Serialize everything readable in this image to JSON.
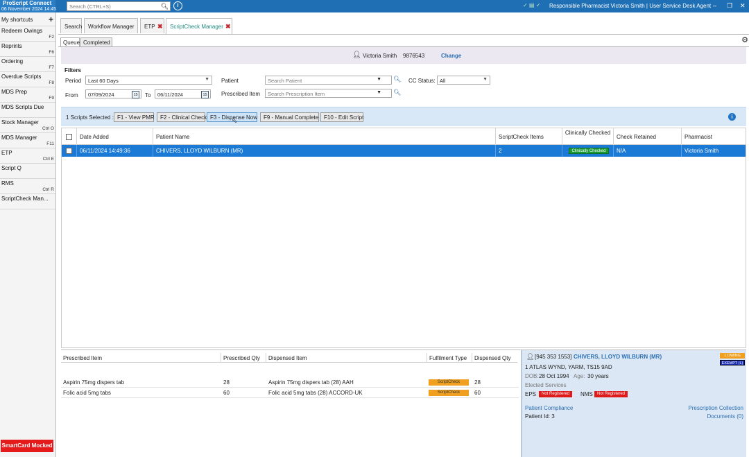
{
  "app": {
    "name": "ProScript Connect",
    "datetime": "06 November 2024 14:45",
    "search_placeholder": "Search (CTRL+S)",
    "status_icons": "✓ ▤ ✓",
    "responsible_pharmacist": "Responsible Pharmacist Victoria Smith",
    "user_role": "User Service Desk Agent"
  },
  "sidebar": {
    "shortcuts_label": "My shortcuts",
    "items": [
      {
        "label": "Redeem Owings",
        "key": "F2"
      },
      {
        "label": "Reprints",
        "key": "F6"
      },
      {
        "label": "Ordering",
        "key": "F7"
      },
      {
        "label": "Overdue Scripts",
        "key": "F8"
      },
      {
        "label": "MDS Prep",
        "key": "F9"
      },
      {
        "label": "MDS Scripts Due",
        "key": ""
      },
      {
        "label": "Stock Manager",
        "key": "Ctrl O"
      },
      {
        "label": "MDS Manager",
        "key": "F11"
      },
      {
        "label": "ETP",
        "key": "Ctrl E"
      },
      {
        "label": "Script Q",
        "key": ""
      },
      {
        "label": "RMS",
        "key": "Ctrl R"
      },
      {
        "label": "ScriptCheck Man...",
        "key": ""
      }
    ],
    "smartcard": "SmartCard Mocked"
  },
  "tabs": [
    {
      "label": "Search"
    },
    {
      "label": "Workflow Manager"
    },
    {
      "label": "ETP"
    },
    {
      "label": "ScriptCheck Manager"
    }
  ],
  "subtabs": [
    {
      "label": "Queue"
    },
    {
      "label": "Completed"
    }
  ],
  "user": {
    "name": "Victoria Smith",
    "id": "9876543",
    "change": "Change"
  },
  "filters": {
    "title": "Filters",
    "period_label": "Period",
    "period_value": "Last 60 Days",
    "from_label": "From",
    "from_value": "07/09/2024",
    "to_label": "To",
    "to_value": "06/11/2024",
    "patient_label": "Patient",
    "patient_placeholder": "Search Patient",
    "prescribed_label": "Prescribed Item",
    "prescribed_placeholder": "Search Prescription Item",
    "cc_status_label": "CC Status:",
    "cc_status_value": "All"
  },
  "actions": {
    "selected": "1 Scripts Selected :",
    "buttons": [
      "F1 - View PMR",
      "F2 - Clinical Check",
      "F3 - Dispense Now",
      "F9 - Manual Complete",
      "F10 - Edit Script"
    ]
  },
  "grid": {
    "headers": [
      "Date Added",
      "Patient Name",
      "ScriptCheck Items",
      "Clinically Checked",
      "Check Retained",
      "Pharmacist"
    ],
    "row": {
      "date": "06/11/2024 14:49:36",
      "patient": "CHIVERS, LLOYD WILBURN (MR)",
      "items": "2",
      "clinically": "Clinically Checked",
      "retained": "N/A",
      "pharmacist": "Victoria  Smith"
    }
  },
  "items_table": {
    "headers": [
      "Prescribed Item",
      "Prescribed Qty",
      "Dispensed Item",
      "Fulfilment Type",
      "Dispensed Qty"
    ],
    "rows": [
      {
        "prescribed": "Aspirin 75mg dispers tab",
        "pqty": "28",
        "dispensed": "Aspirin 75mg dispers tab (28) AAH",
        "type": "ScriptCheck",
        "dqty": "28"
      },
      {
        "prescribed": "Folic acid 5mg tabs",
        "pqty": "60",
        "dispensed": "Folic acid 5mg tabs (28) ACCORD-UK",
        "type": "ScriptCheck",
        "dqty": "60"
      }
    ]
  },
  "patient": {
    "nhs": "[945 353 1553]",
    "name": "CHIVERS, LLOYD WILBURN (MR)",
    "owing": "1 OWING",
    "exempt": "EXEMPT (L)",
    "address": "1 ATLAS WYND, YARM, TS15 9AD",
    "dob_label": "DOB:",
    "dob": "28 Oct 1994",
    "age_label": "Age:",
    "age": "30 years",
    "elected": "Elected Services",
    "eps_label": "EPS",
    "eps_status": "Not Registered",
    "nms_label": "NMS",
    "nms_status": "Not Registered",
    "compliance": "Patient Compliance",
    "collection": "Prescription Collection",
    "patient_id": "Patient Id: 3",
    "documents": "Documents (0)"
  }
}
